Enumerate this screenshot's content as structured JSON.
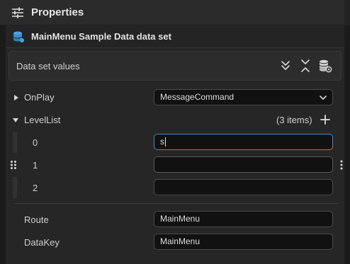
{
  "window": {
    "title": "Properties",
    "title_icon": "sliders-icon"
  },
  "dataset": {
    "title": "MainMenu Sample Data data set",
    "icon": "database-icon"
  },
  "values_box": {
    "label": "Data set values",
    "buttons": [
      "expand-all-icon",
      "collapse-all-icon",
      "database-settings-icon"
    ]
  },
  "properties": {
    "onplay": {
      "label": "OnPlay",
      "value": "MessageCommand"
    },
    "levellist": {
      "label": "LevelList",
      "count": "(3 items)",
      "items": [
        {
          "index": "0",
          "value": "s"
        },
        {
          "index": "1",
          "value": ""
        },
        {
          "index": "2",
          "value": ""
        }
      ]
    },
    "route": {
      "label": "Route",
      "value": "MainMenu"
    },
    "datakey": {
      "label": "DataKey",
      "value": "MainMenu"
    }
  },
  "colors": {
    "accent": "#4a88c7",
    "background": "#262626",
    "field": "#111111"
  }
}
